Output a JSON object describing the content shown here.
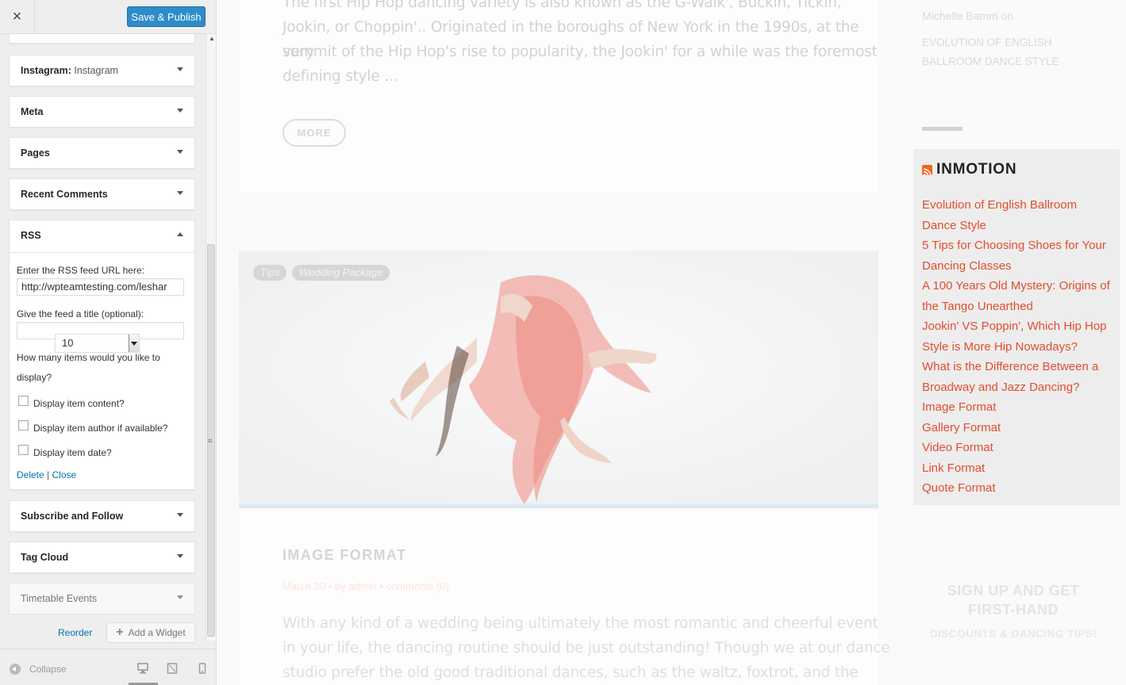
{
  "sidebar": {
    "close_label": "×",
    "publish_label": "Save & Publish",
    "widgets": [
      {
        "title": "Instagram:",
        "subtitle": "Instagram"
      },
      {
        "title": "Meta"
      },
      {
        "title": "Pages"
      },
      {
        "title": "Recent Comments"
      },
      {
        "title": "RSS"
      },
      {
        "title": "Subscribe and Follow"
      },
      {
        "title": "Tag Cloud"
      },
      {
        "title": "Timetable Events"
      }
    ],
    "rss_form": {
      "url_label": "Enter the RSS feed URL here:",
      "url_value": "http://wpteamtesting.com/leshar",
      "title_label": "Give the feed a title (optional):",
      "title_value": "",
      "count_label_line1": "How many items would you like to",
      "count_label_line2": "display?",
      "count_value": "10",
      "opt_content": "Display item content?",
      "opt_author": "Display item author if available?",
      "opt_date": "Display item date?",
      "delete_label": "Delete",
      "separator": "|",
      "close_label": "Close"
    },
    "reorder_label": "Reorder",
    "add_widget_label": "Add a Widget",
    "collapse_label": "Collapse"
  },
  "preview": {
    "excerpt_lines": [
      "The first Hip Hop dancing variety is also known as the G-Walk', Buckin, Tickin,",
      "Jookin, or Choppin'.. Originated in the boroughs of New York in the 1990s, at the very",
      "summit of the Hip Hop's rise to popularity, the Jookin' for a while was the foremost",
      "defining style ..."
    ],
    "more_label": "MORE",
    "tags": [
      "Tips",
      "Wedding Package"
    ],
    "post_title": "IMAGE FORMAT",
    "post_meta": "March 30  •  by admin  •  comments (0)",
    "post_excerpt_lines": [
      "With any kind of a wedding being ultimately the most romantic and cheerful event",
      "in your life, the dancing routine should be just outstanding! Though we at our dance",
      "studio prefer the old good traditional dances, such as the waltz, foxtrot, and the"
    ],
    "sidebar": {
      "comment_author": "Michelle Bamm on",
      "comment_post": "EVOLUTION OF ENGLISH BALLROOM DANCE STYLE",
      "rss_title": "INMOTION",
      "rss_items": [
        "Evolution of English Ballroom Dance Style",
        "5 Tips for Choosing Shoes for Your Dancing Classes",
        "A 100 Years Old Mystery: Origins of the Tango Unearthed",
        "Jookin' VS Poppin', Which Hip Hop Style is More Hip Nowadays?",
        "What is the Difference Between a Broadway and Jazz Dancing?",
        "Image Format",
        "Gallery Format",
        "Video Format",
        "Link Format",
        "Quote Format"
      ],
      "signup_title": "SIGN UP AND GET FIRST-HAND",
      "signup_sub": "DISCOUNTS & DANCING TIPS!"
    }
  },
  "colors": {
    "publish_button": "#2e8cc8",
    "link_blue": "#0073aa",
    "rss_link": "#e44d2e",
    "rss_icon": "#f26522"
  }
}
